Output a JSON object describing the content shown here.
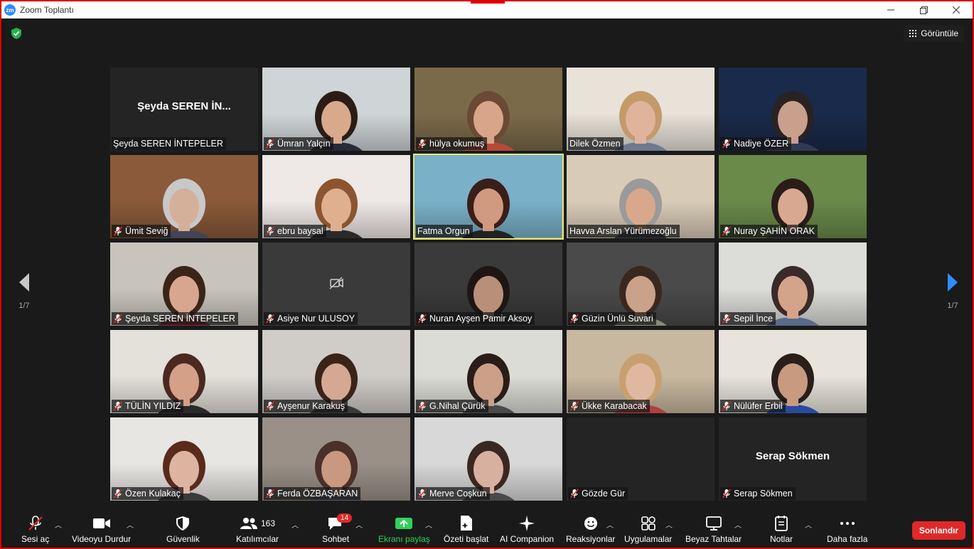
{
  "window": {
    "title": "Zoom Toplantı"
  },
  "header": {
    "view_label": "Görüntüle"
  },
  "pagination": {
    "left": "1/7",
    "right": "1/7"
  },
  "participants": [
    {
      "name": "Şeyda SEREN İNTEPELER",
      "display": "Şeyda SEREN İN...",
      "muted": false,
      "video": false,
      "bg": "#242424"
    },
    {
      "name": "Ümran Yalçın",
      "muted": true,
      "video": true,
      "bg": "#cfd4d6",
      "skin": "#d9a98c",
      "hair": "#2b1d16",
      "shirt": "#2a2a3a"
    },
    {
      "name": "hülya okumuş",
      "muted": true,
      "video": true,
      "bg": "#7b6a4a",
      "skin": "#d8a58a",
      "hair": "#6a4a35",
      "shirt": "#b8483a"
    },
    {
      "name": "Dilek Özmen",
      "muted": false,
      "video": true,
      "bg": "#e8e2d8",
      "skin": "#e0b49c",
      "hair": "#c49a6a",
      "shirt": "#6d7a90"
    },
    {
      "name": "Nadiye ÖZER",
      "muted": true,
      "video": true,
      "bg": "#1a2a4a",
      "skin": "#c9a08c",
      "hair": "#2a2222",
      "shirt": "#303a55"
    },
    {
      "name": "Ümit Seviğ",
      "muted": true,
      "video": true,
      "bg": "#8a5a3a",
      "skin": "#d4b09a",
      "hair": "#c8c8c8",
      "shirt": "#444455"
    },
    {
      "name": "ebru baysal",
      "muted": true,
      "video": true,
      "bg": "#eee8e6",
      "skin": "#e0b08e",
      "hair": "#8a5530",
      "shirt": "#2a2a2a"
    },
    {
      "name": "Fatma Orgun",
      "muted": false,
      "video": true,
      "active": true,
      "bg": "#7ab0c8",
      "skin": "#cf9a80",
      "hair": "#3a1e18",
      "shirt": "#222222"
    },
    {
      "name": "Havva Arslan Yürümezoğlu",
      "muted": false,
      "video": true,
      "bg": "#d8cbb8",
      "skin": "#d8a88c",
      "hair": "#9a9a9a",
      "shirt": "#3a3a48"
    },
    {
      "name": "Nuray ŞAHİN ORAK",
      "muted": true,
      "video": true,
      "bg": "#6a8a4a",
      "skin": "#d8a890",
      "hair": "#2a1c18",
      "shirt": "#3a3a3a"
    },
    {
      "name": "Şeyda SEREN İNTEPELER",
      "muted": true,
      "video": true,
      "bg": "#c8c4bc",
      "skin": "#d8a58e",
      "hair": "#3a2418",
      "shirt": "#8a2a2a"
    },
    {
      "name": "Asiye Nur ULUSOY",
      "muted": true,
      "video": false,
      "videooff": true,
      "bg": "#3a3a3a"
    },
    {
      "name": "Nuran Ayşen Pamir Aksoy",
      "muted": true,
      "video": true,
      "bg": "#3a3a3a",
      "skin": "#b8907a",
      "hair": "#1e1614",
      "shirt": "#2a2a2a"
    },
    {
      "name": "Güzin Ünlü Suvari",
      "muted": true,
      "video": true,
      "bg": "#4a4a4a",
      "skin": "#caa28a",
      "hair": "#3a2820",
      "shirt": "#8a8a7a"
    },
    {
      "name": "Sepil İnce",
      "muted": true,
      "video": true,
      "bg": "#dcdcd8",
      "skin": "#d4a48a",
      "hair": "#3a2a2a",
      "shirt": "#5a6a8a"
    },
    {
      "name": "TÜLİN YILDIZ",
      "muted": true,
      "video": true,
      "bg": "#e4e0da",
      "skin": "#d4a088",
      "hair": "#4a2a20",
      "shirt": "#2a2a2a"
    },
    {
      "name": "Ayşenur Karakuş",
      "muted": true,
      "video": true,
      "bg": "#d0ccc8",
      "skin": "#d4a892",
      "hair": "#3a2418",
      "shirt": "#3a3a3a"
    },
    {
      "name": "G.Nihal Çürük",
      "muted": true,
      "video": true,
      "bg": "#dcdcd6",
      "skin": "#caa088",
      "hair": "#2a1c18",
      "shirt": "#4a4a4a"
    },
    {
      "name": "Ükke Karabacak",
      "muted": true,
      "video": true,
      "bg": "#c8b8a0",
      "skin": "#e0b8a0",
      "hair": "#c8a070",
      "shirt": "#b04040"
    },
    {
      "name": "Nülüfer Erbil",
      "muted": true,
      "video": true,
      "bg": "#e8e4dc",
      "skin": "#c89a80",
      "hair": "#2a1e1a",
      "shirt": "#2a4aa0"
    },
    {
      "name": "Özen Kulakaç",
      "muted": true,
      "video": true,
      "bg": "#e8e6e2",
      "skin": "#dcb4a0",
      "hair": "#5a2a1a",
      "shirt": "#3a3a3a"
    },
    {
      "name": "Ferda ÖZBAŞARAN",
      "muted": true,
      "video": true,
      "bg": "#9a9088",
      "skin": "#c89880",
      "hair": "#4a3028",
      "shirt": "#5a5a6a"
    },
    {
      "name": "Merve Coşkun",
      "muted": true,
      "video": true,
      "bg": "#d8d8d8",
      "skin": "#d8b0a0",
      "hair": "#3a2820",
      "shirt": "#4a4a4a"
    },
    {
      "name": "Gözde Gür",
      "muted": true,
      "video": false,
      "bg": "#242424"
    },
    {
      "name": "Serap Sökmen",
      "display": "Serap Sökmen",
      "muted": true,
      "video": false,
      "bg": "#242424"
    }
  ],
  "toolbar": {
    "audio": "Sesi aç",
    "video": "Videoyu Durdur",
    "security": "Güvenlik",
    "participants": "Katılımcılar",
    "participants_count": "163",
    "chat": "Sohbet",
    "chat_badge": "14",
    "share": "Ekranı paylaş",
    "summary": "Özeti başlat",
    "ai": "AI Companion",
    "reactions": "Reaksiyonlar",
    "apps": "Uygulamalar",
    "whiteboard": "Beyaz Tahtalar",
    "notes": "Notlar",
    "more": "Daha fazla",
    "end": "Sonlandır"
  },
  "colors": {
    "end_button": "#e02828",
    "share_green": "#2fd35a",
    "active_speaker": "#e5e57a",
    "window_border": "#e00000"
  }
}
